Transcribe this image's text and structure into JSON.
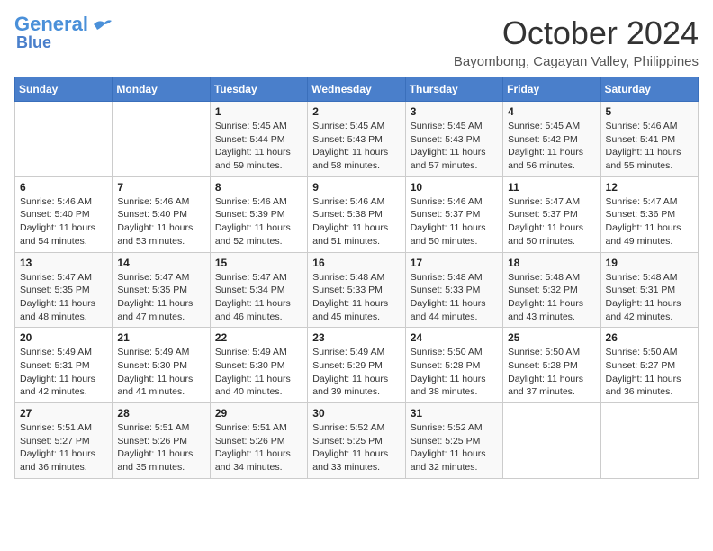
{
  "logo": {
    "line1": "General",
    "line2": "Blue"
  },
  "title": {
    "month_year": "October 2024",
    "location": "Bayombong, Cagayan Valley, Philippines"
  },
  "header_days": [
    "Sunday",
    "Monday",
    "Tuesday",
    "Wednesday",
    "Thursday",
    "Friday",
    "Saturday"
  ],
  "weeks": [
    [
      {
        "day": "",
        "detail": ""
      },
      {
        "day": "",
        "detail": ""
      },
      {
        "day": "1",
        "detail": "Sunrise: 5:45 AM\nSunset: 5:44 PM\nDaylight: 11 hours and 59 minutes."
      },
      {
        "day": "2",
        "detail": "Sunrise: 5:45 AM\nSunset: 5:43 PM\nDaylight: 11 hours and 58 minutes."
      },
      {
        "day": "3",
        "detail": "Sunrise: 5:45 AM\nSunset: 5:43 PM\nDaylight: 11 hours and 57 minutes."
      },
      {
        "day": "4",
        "detail": "Sunrise: 5:45 AM\nSunset: 5:42 PM\nDaylight: 11 hours and 56 minutes."
      },
      {
        "day": "5",
        "detail": "Sunrise: 5:46 AM\nSunset: 5:41 PM\nDaylight: 11 hours and 55 minutes."
      }
    ],
    [
      {
        "day": "6",
        "detail": "Sunrise: 5:46 AM\nSunset: 5:40 PM\nDaylight: 11 hours and 54 minutes."
      },
      {
        "day": "7",
        "detail": "Sunrise: 5:46 AM\nSunset: 5:40 PM\nDaylight: 11 hours and 53 minutes."
      },
      {
        "day": "8",
        "detail": "Sunrise: 5:46 AM\nSunset: 5:39 PM\nDaylight: 11 hours and 52 minutes."
      },
      {
        "day": "9",
        "detail": "Sunrise: 5:46 AM\nSunset: 5:38 PM\nDaylight: 11 hours and 51 minutes."
      },
      {
        "day": "10",
        "detail": "Sunrise: 5:46 AM\nSunset: 5:37 PM\nDaylight: 11 hours and 50 minutes."
      },
      {
        "day": "11",
        "detail": "Sunrise: 5:47 AM\nSunset: 5:37 PM\nDaylight: 11 hours and 50 minutes."
      },
      {
        "day": "12",
        "detail": "Sunrise: 5:47 AM\nSunset: 5:36 PM\nDaylight: 11 hours and 49 minutes."
      }
    ],
    [
      {
        "day": "13",
        "detail": "Sunrise: 5:47 AM\nSunset: 5:35 PM\nDaylight: 11 hours and 48 minutes."
      },
      {
        "day": "14",
        "detail": "Sunrise: 5:47 AM\nSunset: 5:35 PM\nDaylight: 11 hours and 47 minutes."
      },
      {
        "day": "15",
        "detail": "Sunrise: 5:47 AM\nSunset: 5:34 PM\nDaylight: 11 hours and 46 minutes."
      },
      {
        "day": "16",
        "detail": "Sunrise: 5:48 AM\nSunset: 5:33 PM\nDaylight: 11 hours and 45 minutes."
      },
      {
        "day": "17",
        "detail": "Sunrise: 5:48 AM\nSunset: 5:33 PM\nDaylight: 11 hours and 44 minutes."
      },
      {
        "day": "18",
        "detail": "Sunrise: 5:48 AM\nSunset: 5:32 PM\nDaylight: 11 hours and 43 minutes."
      },
      {
        "day": "19",
        "detail": "Sunrise: 5:48 AM\nSunset: 5:31 PM\nDaylight: 11 hours and 42 minutes."
      }
    ],
    [
      {
        "day": "20",
        "detail": "Sunrise: 5:49 AM\nSunset: 5:31 PM\nDaylight: 11 hours and 42 minutes."
      },
      {
        "day": "21",
        "detail": "Sunrise: 5:49 AM\nSunset: 5:30 PM\nDaylight: 11 hours and 41 minutes."
      },
      {
        "day": "22",
        "detail": "Sunrise: 5:49 AM\nSunset: 5:30 PM\nDaylight: 11 hours and 40 minutes."
      },
      {
        "day": "23",
        "detail": "Sunrise: 5:49 AM\nSunset: 5:29 PM\nDaylight: 11 hours and 39 minutes."
      },
      {
        "day": "24",
        "detail": "Sunrise: 5:50 AM\nSunset: 5:28 PM\nDaylight: 11 hours and 38 minutes."
      },
      {
        "day": "25",
        "detail": "Sunrise: 5:50 AM\nSunset: 5:28 PM\nDaylight: 11 hours and 37 minutes."
      },
      {
        "day": "26",
        "detail": "Sunrise: 5:50 AM\nSunset: 5:27 PM\nDaylight: 11 hours and 36 minutes."
      }
    ],
    [
      {
        "day": "27",
        "detail": "Sunrise: 5:51 AM\nSunset: 5:27 PM\nDaylight: 11 hours and 36 minutes."
      },
      {
        "day": "28",
        "detail": "Sunrise: 5:51 AM\nSunset: 5:26 PM\nDaylight: 11 hours and 35 minutes."
      },
      {
        "day": "29",
        "detail": "Sunrise: 5:51 AM\nSunset: 5:26 PM\nDaylight: 11 hours and 34 minutes."
      },
      {
        "day": "30",
        "detail": "Sunrise: 5:52 AM\nSunset: 5:25 PM\nDaylight: 11 hours and 33 minutes."
      },
      {
        "day": "31",
        "detail": "Sunrise: 5:52 AM\nSunset: 5:25 PM\nDaylight: 11 hours and 32 minutes."
      },
      {
        "day": "",
        "detail": ""
      },
      {
        "day": "",
        "detail": ""
      }
    ]
  ]
}
